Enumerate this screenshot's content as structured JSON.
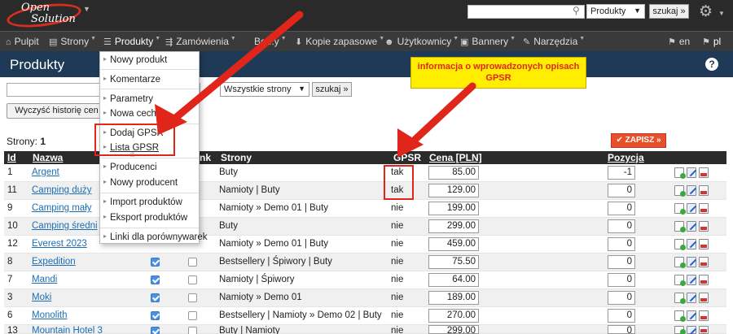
{
  "logo": {
    "line1": "Open",
    "line2": "Solution"
  },
  "topbar": {
    "search_type": "Produkty",
    "search_button": "szukaj »"
  },
  "nav": {
    "items": [
      {
        "label": "Pulpit"
      },
      {
        "label": "Strony"
      },
      {
        "label": "Produkty"
      },
      {
        "label": "Zamówienia"
      },
      {
        "label": "Bo...y"
      },
      {
        "label": "Kopie zapasowe"
      },
      {
        "label": "Użytkownicy"
      },
      {
        "label": "Bannery"
      },
      {
        "label": "Narzędzia"
      }
    ],
    "lang_en": "en",
    "lang_pl": "pl"
  },
  "page": {
    "title": "Produkty",
    "help": "?"
  },
  "filters": {
    "pages_select": "Wszystkie strony",
    "search_button": "szukaj »",
    "clear_history": "Wyczyść historię cen"
  },
  "pages_row": {
    "label": "Strony:",
    "value": "1"
  },
  "save_button": "ZAPISZ »",
  "table": {
    "headers": {
      "id": "Id",
      "name": "Nazwa",
      "nk": "nk",
      "pages": "Strony",
      "gpsr": "GPSR",
      "price": "Cena [PLN]",
      "position": "Pozycja"
    },
    "rows": [
      {
        "id": "1",
        "name": "Argent",
        "pages": "Buty",
        "gpsr": "tak",
        "price": "85.00",
        "position": "-1"
      },
      {
        "id": "11",
        "name": "Camping duży",
        "pages": "Namioty | Buty",
        "gpsr": "tak",
        "price": "129.00",
        "position": "0"
      },
      {
        "id": "9",
        "name": "Camping mały",
        "pages": "Namioty » Demo 01 | Buty",
        "gpsr": "nie",
        "price": "199.00",
        "position": "0"
      },
      {
        "id": "10",
        "name": "Camping średni",
        "pages": "Buty",
        "gpsr": "nie",
        "price": "299.00",
        "position": "0"
      },
      {
        "id": "12",
        "name": "Everest 2023",
        "pages": "Namioty » Demo 01 | Buty",
        "gpsr": "nie",
        "price": "459.00",
        "position": "0"
      },
      {
        "id": "8",
        "name": "Expedition",
        "pages": "Bestsellery | Śpiwory | Buty",
        "gpsr": "nie",
        "price": "75.50",
        "position": "0"
      },
      {
        "id": "7",
        "name": "Mandi",
        "pages": "Namioty | Śpiwory",
        "gpsr": "nie",
        "price": "64.00",
        "position": "0"
      },
      {
        "id": "3",
        "name": "Moki",
        "pages": "Namioty » Demo 01",
        "gpsr": "nie",
        "price": "189.00",
        "position": "0"
      },
      {
        "id": "6",
        "name": "Monolith",
        "pages": "Bestsellery | Namioty » Demo 02 | Buty",
        "gpsr": "nie",
        "price": "270.00",
        "position": "0"
      },
      {
        "id": "13",
        "name": "Mountain Hotel 3",
        "pages": "Buty | Namioty",
        "gpsr": "nie",
        "price": "299.00",
        "position": "0"
      }
    ]
  },
  "menu": {
    "items": [
      {
        "label": "Nowy produkt"
      },
      {
        "label": "Komentarze"
      },
      {
        "label": "Parametry"
      },
      {
        "label": "Nowa cecha"
      },
      {
        "label": "Dodaj GPSR"
      },
      {
        "label": "Lista GPSR"
      },
      {
        "label": "Producenci"
      },
      {
        "label": "Nowy producent"
      },
      {
        "label": "Import produktów"
      },
      {
        "label": "Eksport produktów"
      },
      {
        "label": "Linki dla porównywarek"
      }
    ]
  },
  "callout": {
    "text": "informacja o wprowadzonych opisach GPSR"
  },
  "colors": {
    "accent_red": "#e0261b",
    "header_dark": "#2a2a2a",
    "title_bar": "#1f3a57",
    "callout_yellow": "#ffee00",
    "link": "#1a6eb5",
    "save": "#e8502a"
  }
}
